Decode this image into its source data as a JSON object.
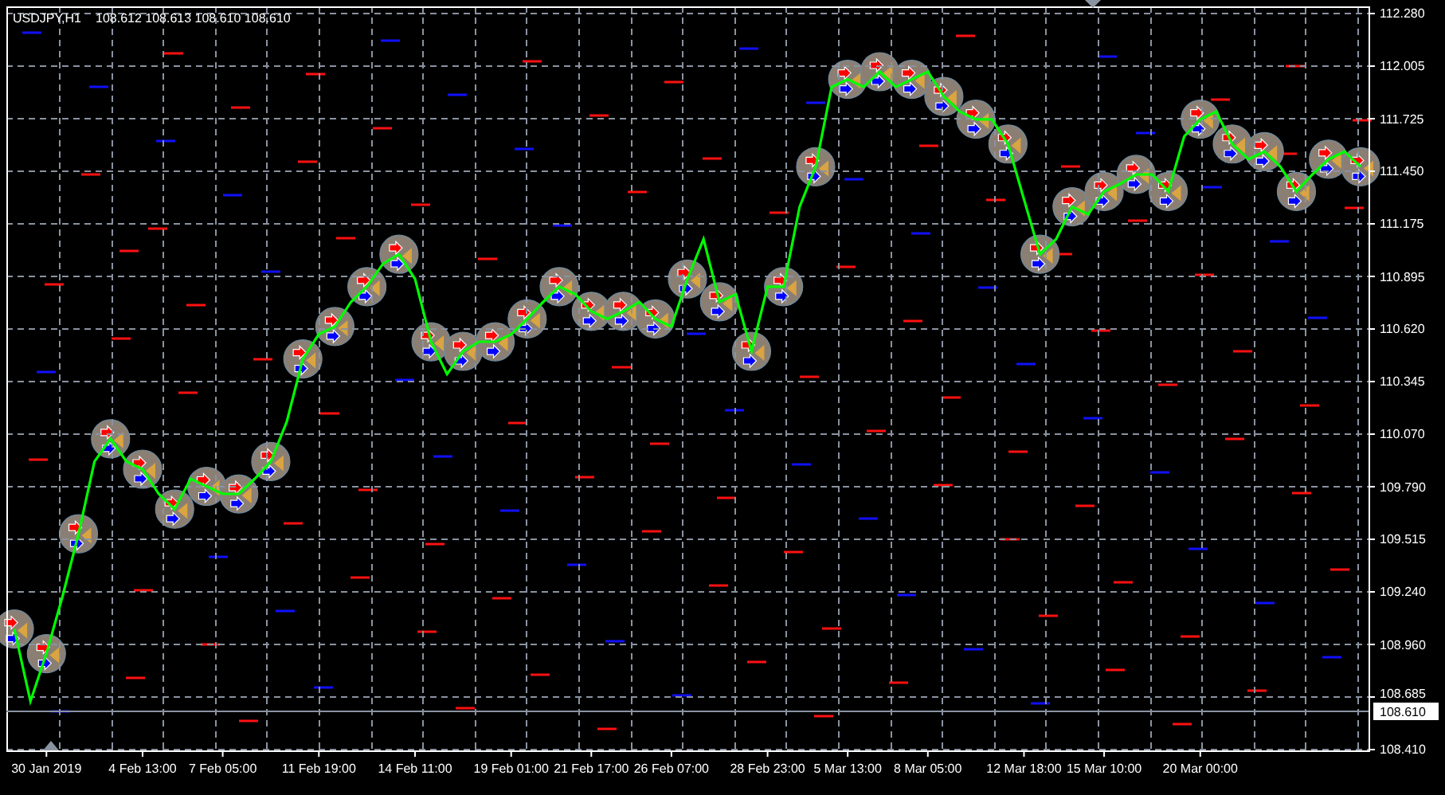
{
  "chart": {
    "quote": "108.612 108.613 108.610 108.610",
    "chart_data": {
      "type": "line",
      "title": "USDJPY,H1",
      "grid": true,
      "ref_lines": [
        {
          "axis": "y",
          "value": 108.61,
          "label": "108.610"
        }
      ],
      "ylim": [
        108.41,
        112.28
      ],
      "categories": [
        null,
        null,
        "30 Jan 2019",
        null,
        null,
        null,
        null,
        null,
        "4 Feb 13:00",
        null,
        null,
        null,
        null,
        "7 Feb 05:00",
        null,
        null,
        null,
        null,
        null,
        "11 Feb 19:00",
        null,
        null,
        null,
        null,
        null,
        "14 Feb 11:00",
        null,
        null,
        null,
        null,
        null,
        "19 Feb 01:00",
        null,
        null,
        null,
        null,
        "21 Feb 17:00",
        null,
        null,
        null,
        null,
        "26 Feb 07:00",
        null,
        null,
        null,
        null,
        null,
        "28 Feb 23:00",
        null,
        null,
        null,
        null,
        "5 Mar 13:00",
        null,
        null,
        null,
        null,
        "8 Mar 05:00",
        null,
        null,
        null,
        null,
        null,
        "12 Mar 18:00",
        null,
        null,
        null,
        null,
        "15 Mar 10:00",
        null,
        null,
        null,
        null,
        null,
        "20 Mar 00:00",
        null,
        null,
        null,
        null,
        null,
        null,
        null,
        null,
        null,
        null
      ],
      "yticks": [
        {
          "value": 112.28,
          "label": "112.280"
        },
        {
          "value": 112.005,
          "label": "112.005"
        },
        {
          "value": 111.725,
          "label": "111.725"
        },
        {
          "value": 111.45,
          "label": "111.450"
        },
        {
          "value": 111.175,
          "label": "111.175"
        },
        {
          "value": 110.895,
          "label": "110.895"
        },
        {
          "value": 110.62,
          "label": "110.620"
        },
        {
          "value": 110.345,
          "label": "110.345"
        },
        {
          "value": 110.07,
          "label": "110.070"
        },
        {
          "value": 109.79,
          "label": "109.790"
        },
        {
          "value": 109.515,
          "label": "109.515"
        },
        {
          "value": 109.24,
          "label": "109.240"
        },
        {
          "value": 108.96,
          "label": "108.960"
        },
        {
          "value": 108.685,
          "label": "108.685"
        },
        {
          "value": 108.41,
          "label": "108.410"
        }
      ],
      "series": [
        {
          "color": "#00ff00",
          "values": [
            109.04,
            108.66,
            108.91,
            109.21,
            109.54,
            109.92,
            110.04,
            109.92,
            109.88,
            109.75,
            109.67,
            109.83,
            109.79,
            109.75,
            109.75,
            109.83,
            109.92,
            110.13,
            110.46,
            110.59,
            110.63,
            110.76,
            110.84,
            110.96,
            111.01,
            110.88,
            110.55,
            110.38,
            110.5,
            110.55,
            110.55,
            110.59,
            110.67,
            110.76,
            110.84,
            110.8,
            110.71,
            110.67,
            110.71,
            110.76,
            110.67,
            110.63,
            110.88,
            111.09,
            110.76,
            110.8,
            110.5,
            110.84,
            110.84,
            111.26,
            111.47,
            111.89,
            111.93,
            111.89,
            111.97,
            111.89,
            111.93,
            111.97,
            111.84,
            111.76,
            111.72,
            111.72,
            111.59,
            111.3,
            111.01,
            111.09,
            111.26,
            111.22,
            111.34,
            111.38,
            111.43,
            111.43,
            111.34,
            111.63,
            111.72,
            111.76,
            111.59,
            111.51,
            111.55,
            111.47,
            111.34,
            111.43,
            111.51,
            111.55,
            111.47
          ]
        }
      ]
    }
  }
}
